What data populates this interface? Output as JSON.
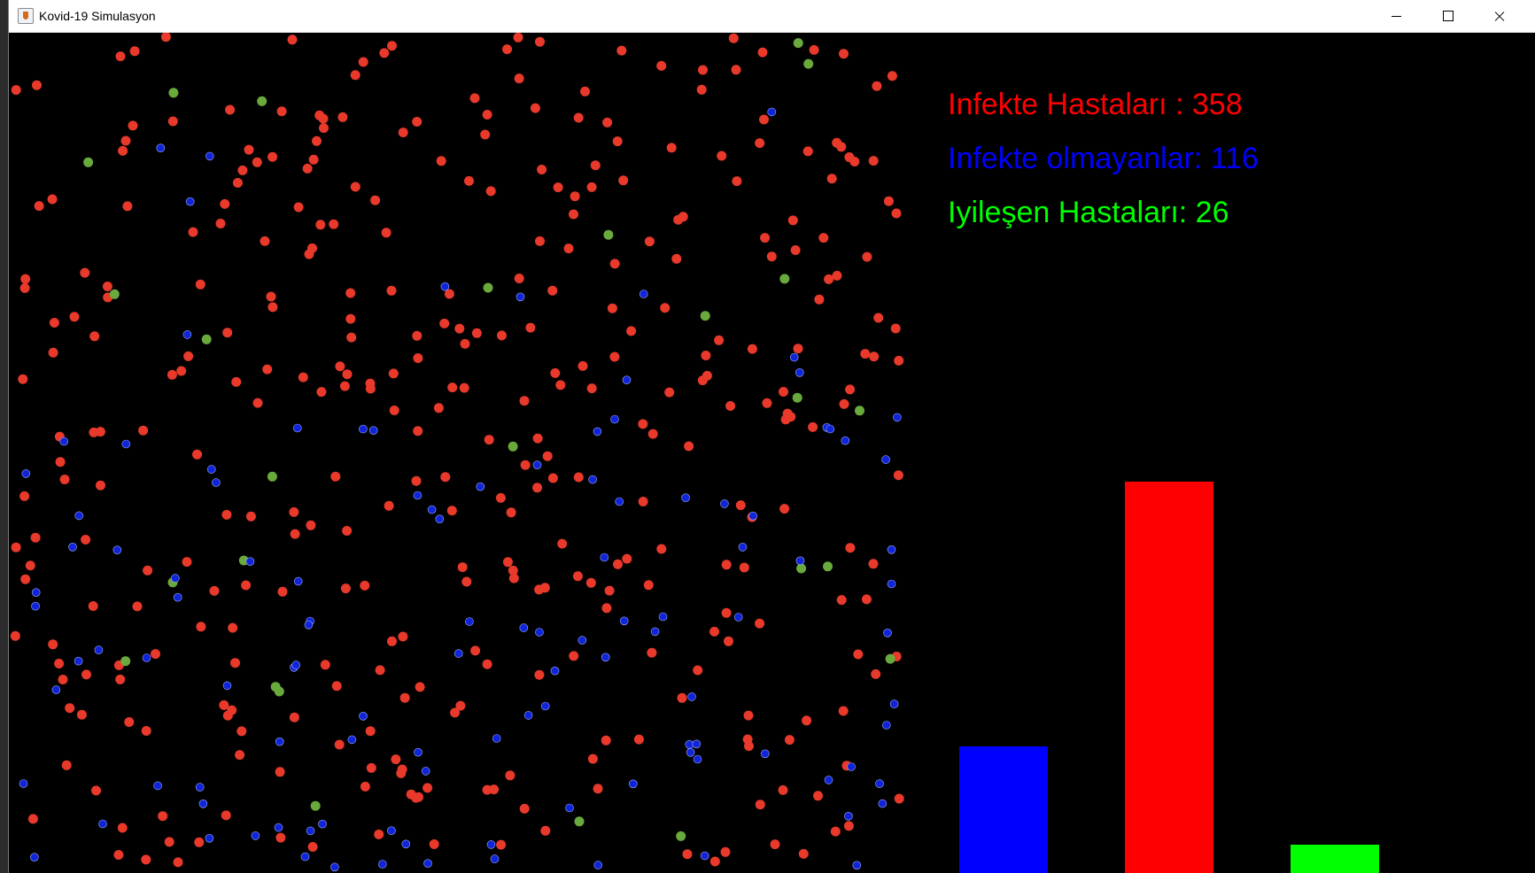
{
  "window": {
    "title": "Kovid-19 Simulasyon"
  },
  "colors": {
    "infected": "#ff0000",
    "uninfected": "#0000ff",
    "recovered": "#00ff00",
    "infected_dot": "#e8392b",
    "uninfected_dot": "#1024d8",
    "recovered_dot": "#6aaa3c",
    "background": "#000000"
  },
  "stats": {
    "infected": {
      "label": "Infekte Hastaları : 358",
      "count": 358
    },
    "uninfected": {
      "label": "Infekte olmayanlar: 116",
      "count": 116
    },
    "recovered": {
      "label": "Iyileşen Hastaları: 26",
      "count": 26
    }
  },
  "icons": {
    "app": "java-cup-icon",
    "minimize": "minimize-icon",
    "maximize": "maximize-icon",
    "close": "close-icon"
  }
}
